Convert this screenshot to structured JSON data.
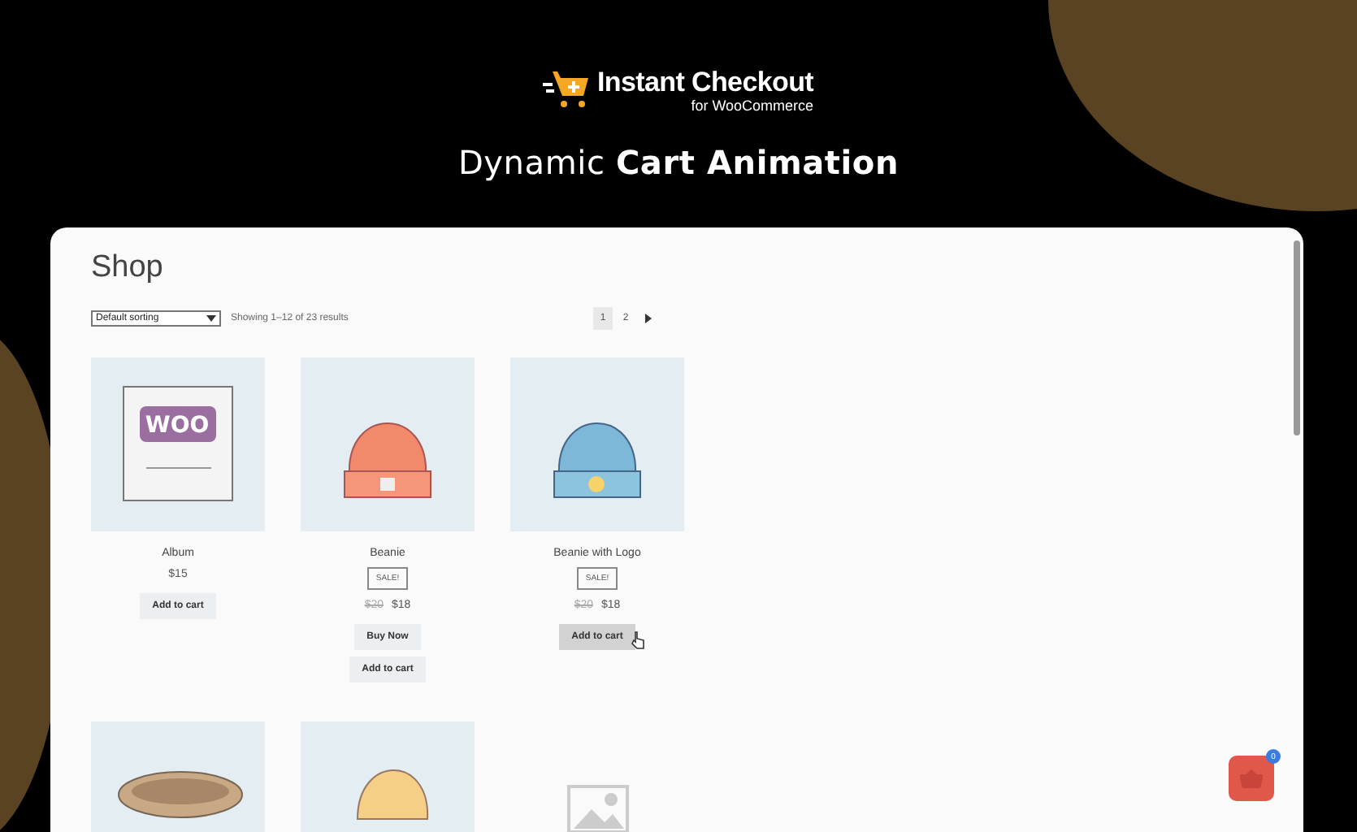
{
  "brand": {
    "name": "Instant Checkout",
    "tagline": "for WooCommerce"
  },
  "headline": "Dynamic **Cart Animation**",
  "shop": {
    "title": "Shop",
    "sorting": "Default sorting",
    "result_count": "Showing 1–12 of 23 results",
    "pages": [
      {
        "label": "1",
        "selected": true
      },
      {
        "label": "2",
        "selected": false
      }
    ],
    "products": [
      {
        "kind": "album",
        "art_text": "WOO",
        "name": "Album",
        "price": "$15",
        "buttons": [
          {
            "label": "Add to cart",
            "hovered": false
          }
        ]
      },
      {
        "kind": "beanie",
        "name": "Beanie",
        "sale": "SALE!",
        "old_price": "$20",
        "price": "$18",
        "buttons": [
          {
            "label": "Buy Now",
            "hovered": false
          },
          {
            "label": "Add to cart",
            "hovered": false
          }
        ]
      },
      {
        "kind": "beanie-logo",
        "name": "Beanie with Logo",
        "sale": "SALE!",
        "old_price": "$20",
        "price": "$18",
        "buttons": [
          {
            "label": "Add to cart",
            "hovered": true
          }
        ]
      },
      {
        "kind": "belt"
      },
      {
        "kind": "cap"
      },
      {
        "kind": "placeholder"
      }
    ]
  },
  "cart": {
    "count": "0"
  }
}
